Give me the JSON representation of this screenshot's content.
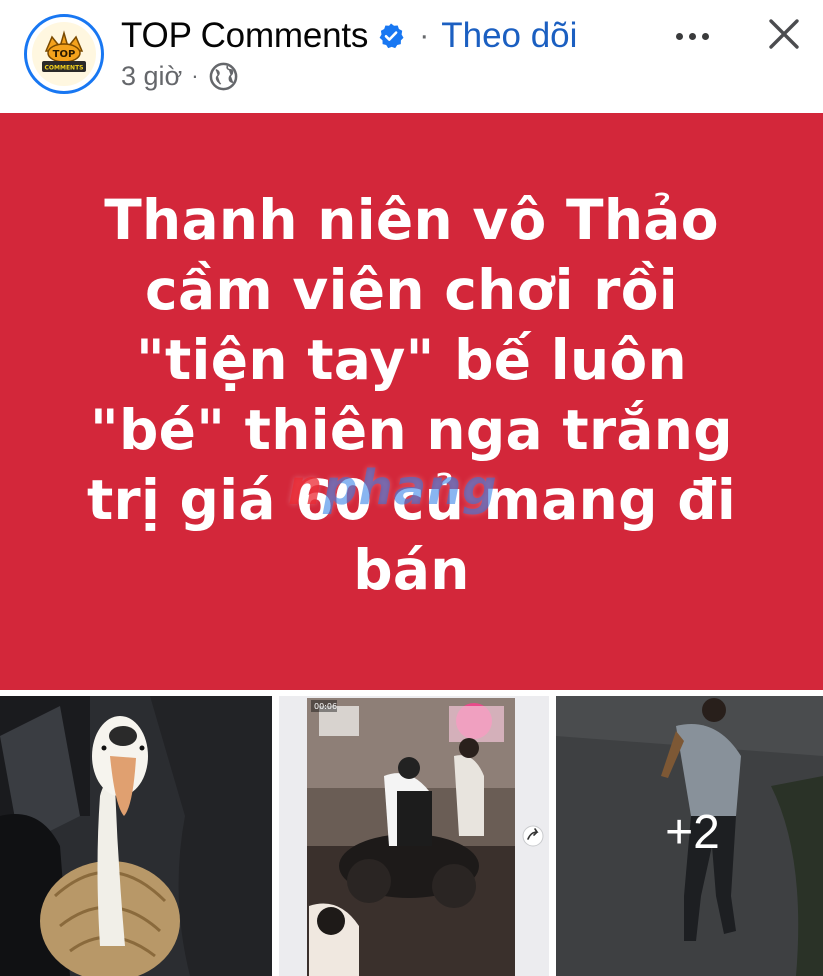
{
  "post": {
    "page_name": "TOP Comments",
    "follow_label": "Theo dõi",
    "time": "3 giờ",
    "separator": "·",
    "avatar_text": "TOP COMMENTS"
  },
  "banner": {
    "headline": "Thanh niên vô Thảo cầm viên chơi rồi \"tiện tay\" bế luôn \"bé\" thiên nga trắng trị giá 60 củ mang đi bán",
    "background": "#d3273a",
    "watermark_red": "n",
    "watermark_blue": "phang"
  },
  "photos": {
    "video_time": "00:06",
    "more_count": "+2"
  },
  "colors": {
    "accent": "#1877f2",
    "follow": "#1b5fc1",
    "banner": "#d3273a"
  },
  "icons": [
    "verified-badge-icon",
    "globe-icon",
    "more-options-icon",
    "close-icon",
    "share-icon"
  ]
}
